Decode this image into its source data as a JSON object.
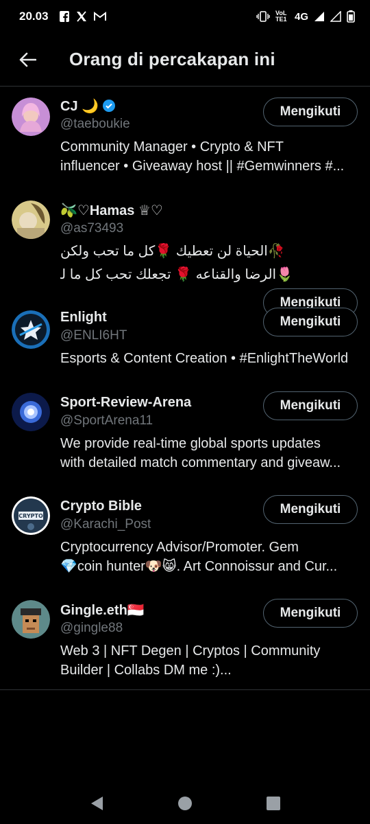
{
  "status_bar": {
    "time": "20.03",
    "left_icons": [
      "facebook-icon",
      "x-icon",
      "gmail-icon"
    ],
    "network": "4G",
    "volte": "VoLTE1"
  },
  "header": {
    "title": "Orang di percakapan ini"
  },
  "people": [
    {
      "name": "CJ 🌙",
      "verified": true,
      "handle": "@taeboukie",
      "bio_lines": [
        "Community Manager • Crypto & NFT",
        "influencer • Giveaway host || #Gemwinners #..."
      ],
      "rtl": false,
      "button": "Mengikuti"
    },
    {
      "name": "🫒♡Hamas ♕♡",
      "verified": false,
      "handle": "@as73493",
      "bio_lines": [
        "🥀الحياة لن تعطيك 🌹كل ما تحب ولكن",
        "🌷الرضا والقناعه 🌹 تجعلك تحب كل ما لدي..."
      ],
      "rtl": true,
      "button": "Mengikuti"
    },
    {
      "name": "Enlight",
      "verified": false,
      "handle": "@ENLI6HT",
      "bio_lines": [
        "Esports & Content Creation • #EnlightTheWorld"
      ],
      "rtl": false,
      "button": "Mengikuti"
    },
    {
      "name": "Sport-Review-Arena",
      "verified": false,
      "handle": "@SportArena11",
      "bio_lines": [
        "We provide real-time global sports updates",
        "with detailed match commentary and giveaw..."
      ],
      "rtl": false,
      "button": "Mengikuti"
    },
    {
      "name": "Crypto Bible",
      "verified": false,
      "handle": "@Karachi_Post",
      "bio_lines": [
        "Cryptocurrency Advisor/Promoter. Gem",
        "💎coin hunter🐶😸.  Art Connoissur and Cur..."
      ],
      "rtl": false,
      "button": "Mengikuti"
    },
    {
      "name": "Gingle.eth🇸🇬",
      "verified": false,
      "handle": "@gingle88",
      "bio_lines": [
        "Web 3 | NFT Degen | Cryptos | Community",
        "Builder | Collabs DM me :)..."
      ],
      "rtl": false,
      "button": "Mengikuti"
    }
  ],
  "colors": {
    "background": "#000000",
    "text_primary": "#e7e9ea",
    "text_secondary": "#71767b",
    "border": "#2f3336",
    "verified": "#1d9bf0"
  }
}
